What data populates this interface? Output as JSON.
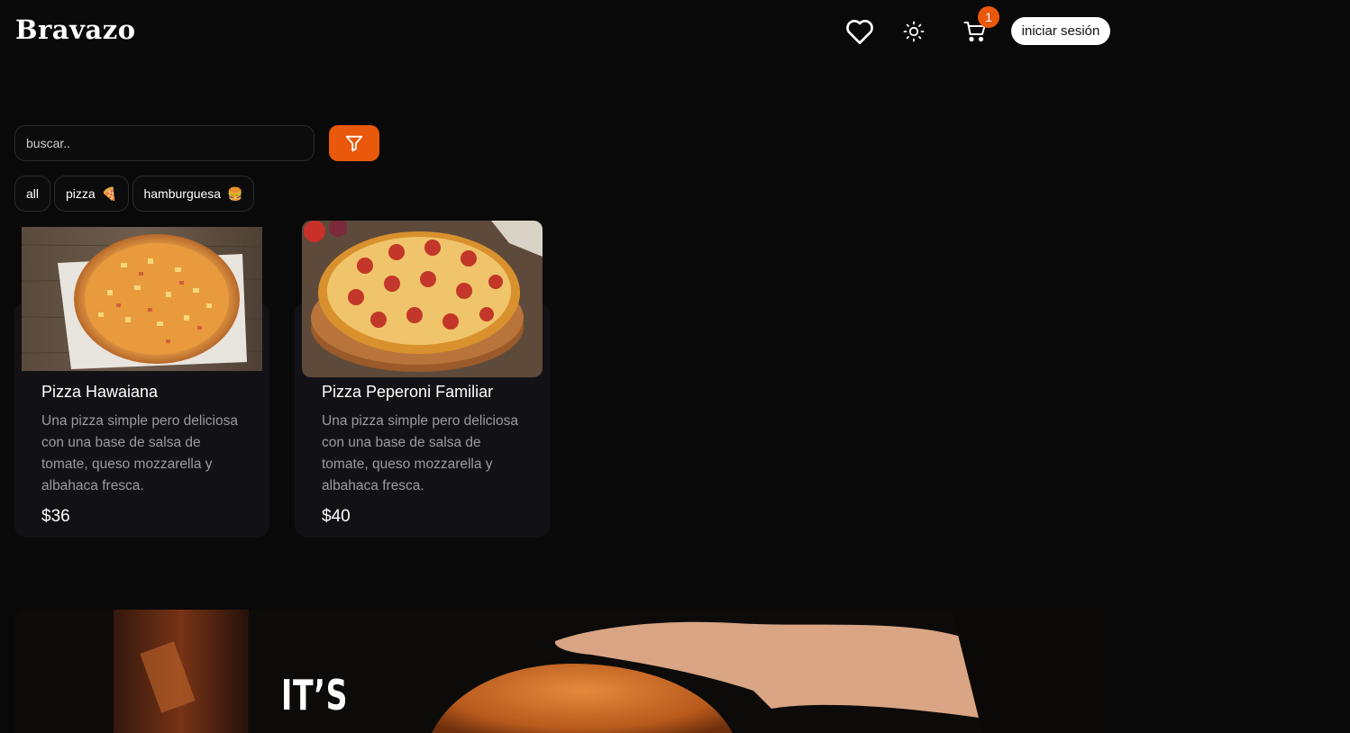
{
  "header": {
    "logo": "Bravazo",
    "cart_count": "1",
    "login_label": "iniciar sesión",
    "icons": [
      "heart-icon",
      "sun-icon",
      "cart-icon"
    ]
  },
  "search": {
    "placeholder": "buscar.."
  },
  "filters": {
    "all": "all",
    "pizza": "pizza",
    "pizza_emoji": "🍕",
    "burger": "hamburguesa",
    "burger_emoji": "🍔"
  },
  "products": [
    {
      "name": "Pizza Hawaiana",
      "description": "Una pizza simple pero deliciosa con una base de salsa de tomate, queso mozzarella y albahaca fresca.",
      "price": "$36"
    },
    {
      "name": "Pizza Peperoni Familiar",
      "description": "Una pizza simple pero deliciosa con una base de salsa de tomate, queso mozzarella y albahaca fresca.",
      "price": "$40"
    }
  ],
  "banner": {
    "line1": "IT’S"
  },
  "colors": {
    "accent": "#ea580c",
    "background": "#0a0909",
    "card": "#121216",
    "muted_text": "#9a9aa3"
  }
}
